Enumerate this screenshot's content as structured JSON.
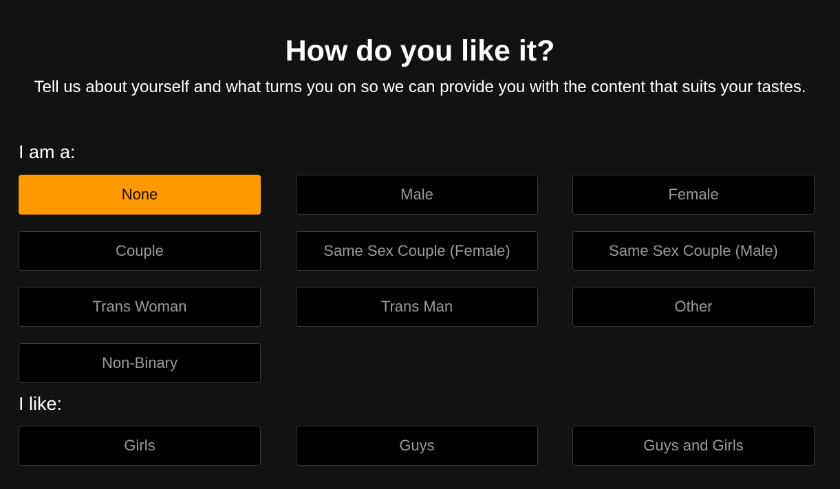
{
  "header": {
    "title": "How do you like it?",
    "subtitle": "Tell us about yourself and what turns you on so we can provide you with the content that suits your tastes."
  },
  "i_am": {
    "label": "I am a:",
    "selected": "None",
    "options": [
      "None",
      "Male",
      "Female",
      "Couple",
      "Same Sex Couple (Female)",
      "Same Sex Couple (Male)",
      "Trans Woman",
      "Trans Man",
      "Other",
      "Non-Binary"
    ]
  },
  "i_like": {
    "label": "I like:",
    "options": [
      "Girls",
      "Guys",
      "Guys and Girls"
    ]
  },
  "colors": {
    "accent": "#ff9900",
    "background": "#121212"
  }
}
